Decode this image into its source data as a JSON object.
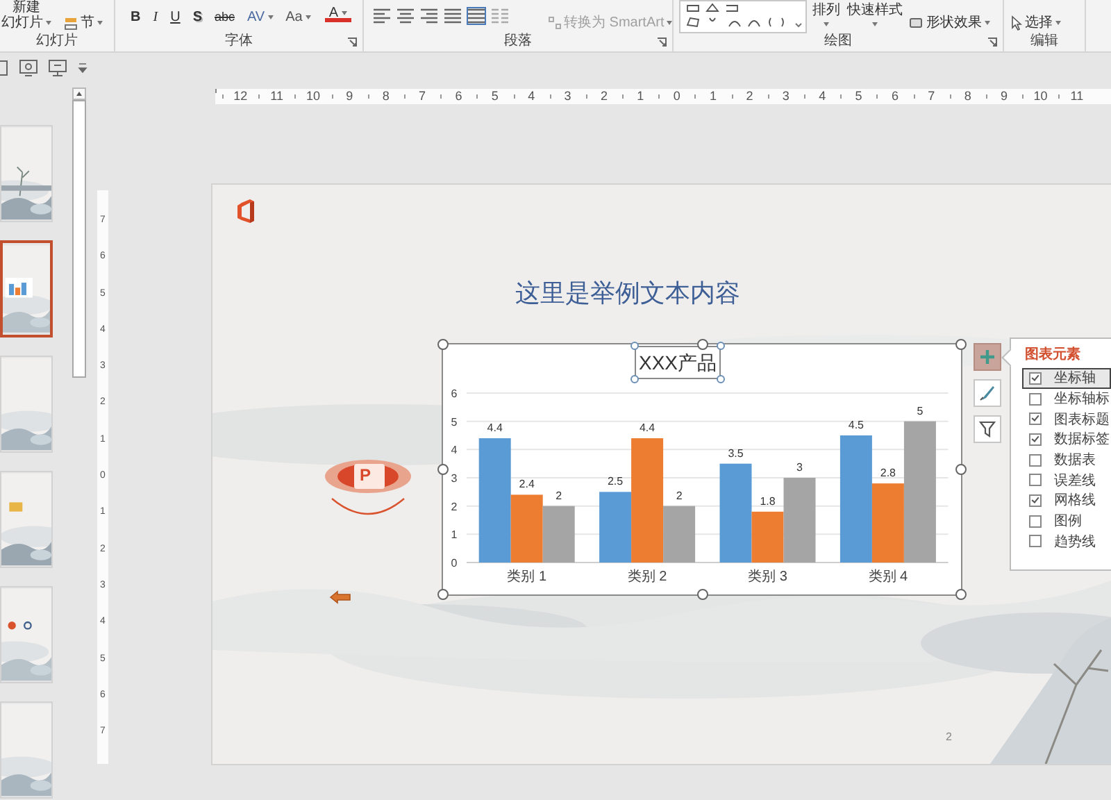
{
  "ribbon": {
    "slides_group": {
      "new_slide": [
        "新建",
        "幻灯片"
      ],
      "section": "节",
      "label": "幻灯片"
    },
    "font_group": {
      "buttons": [
        {
          "text": "B",
          "dropdown": false
        },
        {
          "text": "I",
          "dropdown": false
        },
        {
          "text": "U",
          "dropdown": false
        },
        {
          "text": "S",
          "dropdown": false
        },
        {
          "text": "abc",
          "dropdown": false
        },
        {
          "text": "AV",
          "dropdown": true
        },
        {
          "text": "Aa",
          "dropdown": true
        },
        {
          "text": "A",
          "dropdown": true
        }
      ],
      "label": "字体"
    },
    "paragraph_group": {
      "smartart": {
        "text": "转换为 SmartArt",
        "disabled": true
      },
      "label": "段落"
    },
    "drawing_group": {
      "arrange": "排列",
      "quick_styles": "快速样式",
      "shape_effects": "形状效果",
      "label": "绘图"
    },
    "editing_group": {
      "select": "选择",
      "label": "编辑"
    }
  },
  "rulers": {
    "horizontal": [
      "12",
      "11",
      "10",
      "9",
      "8",
      "7",
      "6",
      "5",
      "4",
      "3",
      "2",
      "1",
      "0",
      "1",
      "2",
      "3",
      "4",
      "5",
      "6",
      "7",
      "8",
      "9",
      "10",
      "11"
    ],
    "vertical": [
      "7",
      "6",
      "5",
      "4",
      "3",
      "2",
      "1",
      "0",
      "1",
      "2",
      "3",
      "4",
      "5",
      "6",
      "7"
    ]
  },
  "slides": [
    {
      "kind": "picture",
      "selected": false
    },
    {
      "kind": "picture",
      "selected": true
    },
    {
      "kind": "picture",
      "selected": false
    },
    {
      "kind": "picture",
      "selected": false
    },
    {
      "kind": "picture",
      "selected": false
    },
    {
      "kind": "picture",
      "selected": false
    }
  ],
  "slide": {
    "title": "这里是举例文本内容",
    "logo_letter": "P",
    "page_number": "2",
    "chart": {
      "chart_data": {
        "type": "bar",
        "title": "XXX产品",
        "categories": [
          "类别 1",
          "类别 2",
          "类别 3",
          "类别 4"
        ],
        "series": [
          {
            "color": "#5b9bd5",
            "values": [
              4.4,
              2.5,
              3.5,
              4.5
            ]
          },
          {
            "color": "#ed7d31",
            "values": [
              2.4,
              4.4,
              1.8,
              2.8
            ]
          },
          {
            "color": "#a5a5a5",
            "values": [
              2,
              2,
              3,
              5
            ]
          }
        ],
        "ylim": [
          0,
          6
        ],
        "yticks": [
          0,
          1,
          2,
          3,
          4,
          5,
          6
        ],
        "grid": true,
        "data_labels": true
      }
    },
    "chart_buttons": [
      {
        "kind": "elements",
        "selected": true
      },
      {
        "kind": "styles",
        "selected": false
      },
      {
        "kind": "filter",
        "selected": false
      }
    ],
    "elements_panel": {
      "title": "图表元素",
      "items": [
        {
          "label": "坐标轴",
          "checked": true,
          "selected": true
        },
        {
          "label": "坐标轴标",
          "checked": false,
          "selected": false
        },
        {
          "label": "图表标题",
          "checked": true,
          "selected": false
        },
        {
          "label": "数据标签",
          "checked": true,
          "selected": false
        },
        {
          "label": "数据表",
          "checked": false,
          "selected": false
        },
        {
          "label": "误差线",
          "checked": false,
          "selected": false
        },
        {
          "label": "网格线",
          "checked": true,
          "selected": false
        },
        {
          "label": "图例",
          "checked": false,
          "selected": false
        },
        {
          "label": "趋势线",
          "checked": false,
          "selected": false
        }
      ]
    }
  }
}
